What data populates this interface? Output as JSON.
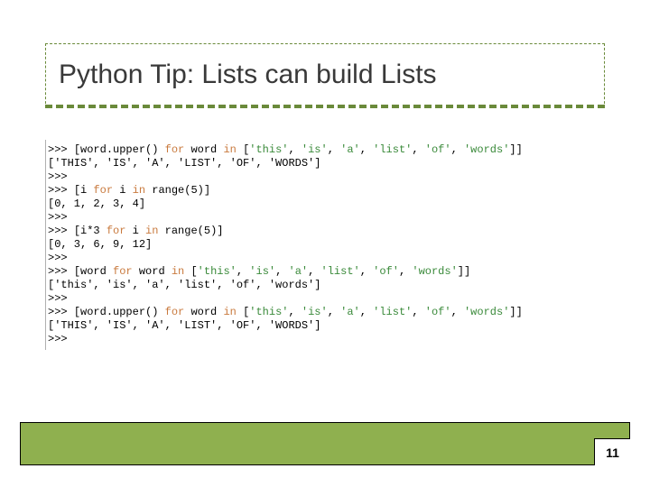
{
  "title": "Python Tip: Lists can build Lists",
  "page_number": "11",
  "colors": {
    "title_border": "#6a8a3a",
    "footer_bg": "#8fb04f",
    "keyword": "#c97a3e",
    "string": "#3a8a3a"
  },
  "code_lines": [
    {
      "prompt": ">>> ",
      "segments": [
        {
          "t": "[word.upper() ",
          "c": "plain"
        },
        {
          "t": "for",
          "c": "kw"
        },
        {
          "t": " word ",
          "c": "plain"
        },
        {
          "t": "in",
          "c": "kw"
        },
        {
          "t": " [",
          "c": "plain"
        },
        {
          "t": "'this'",
          "c": "str"
        },
        {
          "t": ", ",
          "c": "plain"
        },
        {
          "t": "'is'",
          "c": "str"
        },
        {
          "t": ", ",
          "c": "plain"
        },
        {
          "t": "'a'",
          "c": "str"
        },
        {
          "t": ", ",
          "c": "plain"
        },
        {
          "t": "'list'",
          "c": "str"
        },
        {
          "t": ", ",
          "c": "plain"
        },
        {
          "t": "'of'",
          "c": "str"
        },
        {
          "t": ", ",
          "c": "plain"
        },
        {
          "t": "'words'",
          "c": "str"
        },
        {
          "t": "]]",
          "c": "plain"
        }
      ]
    },
    {
      "prompt": "",
      "segments": [
        {
          "t": "['THIS', 'IS', 'A', 'LIST', 'OF', 'WORDS']",
          "c": "plain"
        }
      ]
    },
    {
      "prompt": ">>> ",
      "segments": []
    },
    {
      "prompt": ">>> ",
      "segments": [
        {
          "t": "[i ",
          "c": "plain"
        },
        {
          "t": "for",
          "c": "kw"
        },
        {
          "t": " i ",
          "c": "plain"
        },
        {
          "t": "in",
          "c": "kw"
        },
        {
          "t": " range(5)]",
          "c": "plain"
        }
      ]
    },
    {
      "prompt": "",
      "segments": [
        {
          "t": "[0, 1, 2, 3, 4]",
          "c": "plain"
        }
      ]
    },
    {
      "prompt": ">>> ",
      "segments": []
    },
    {
      "prompt": ">>> ",
      "segments": [
        {
          "t": "[i*3 ",
          "c": "plain"
        },
        {
          "t": "for",
          "c": "kw"
        },
        {
          "t": " i ",
          "c": "plain"
        },
        {
          "t": "in",
          "c": "kw"
        },
        {
          "t": " range(5)]",
          "c": "plain"
        }
      ]
    },
    {
      "prompt": "",
      "segments": [
        {
          "t": "[0, 3, 6, 9, 12]",
          "c": "plain"
        }
      ]
    },
    {
      "prompt": ">>> ",
      "segments": []
    },
    {
      "prompt": ">>> ",
      "segments": [
        {
          "t": "[word ",
          "c": "plain"
        },
        {
          "t": "for",
          "c": "kw"
        },
        {
          "t": " word ",
          "c": "plain"
        },
        {
          "t": "in",
          "c": "kw"
        },
        {
          "t": " [",
          "c": "plain"
        },
        {
          "t": "'this'",
          "c": "str"
        },
        {
          "t": ", ",
          "c": "plain"
        },
        {
          "t": "'is'",
          "c": "str"
        },
        {
          "t": ", ",
          "c": "plain"
        },
        {
          "t": "'a'",
          "c": "str"
        },
        {
          "t": ", ",
          "c": "plain"
        },
        {
          "t": "'list'",
          "c": "str"
        },
        {
          "t": ", ",
          "c": "plain"
        },
        {
          "t": "'of'",
          "c": "str"
        },
        {
          "t": ", ",
          "c": "plain"
        },
        {
          "t": "'words'",
          "c": "str"
        },
        {
          "t": "]]",
          "c": "plain"
        }
      ]
    },
    {
      "prompt": "",
      "segments": [
        {
          "t": "['this', 'is', 'a', 'list', 'of', 'words']",
          "c": "plain"
        }
      ]
    },
    {
      "prompt": ">>> ",
      "segments": []
    },
    {
      "prompt": ">>> ",
      "segments": [
        {
          "t": "[word.upper() ",
          "c": "plain"
        },
        {
          "t": "for",
          "c": "kw"
        },
        {
          "t": " word ",
          "c": "plain"
        },
        {
          "t": "in",
          "c": "kw"
        },
        {
          "t": " [",
          "c": "plain"
        },
        {
          "t": "'this'",
          "c": "str"
        },
        {
          "t": ", ",
          "c": "plain"
        },
        {
          "t": "'is'",
          "c": "str"
        },
        {
          "t": ", ",
          "c": "plain"
        },
        {
          "t": "'a'",
          "c": "str"
        },
        {
          "t": ", ",
          "c": "plain"
        },
        {
          "t": "'list'",
          "c": "str"
        },
        {
          "t": ", ",
          "c": "plain"
        },
        {
          "t": "'of'",
          "c": "str"
        },
        {
          "t": ", ",
          "c": "plain"
        },
        {
          "t": "'words'",
          "c": "str"
        },
        {
          "t": "]]",
          "c": "plain"
        }
      ]
    },
    {
      "prompt": "",
      "segments": [
        {
          "t": "['THIS', 'IS', 'A', 'LIST', 'OF', 'WORDS']",
          "c": "plain"
        }
      ]
    },
    {
      "prompt": ">>> ",
      "segments": []
    }
  ]
}
